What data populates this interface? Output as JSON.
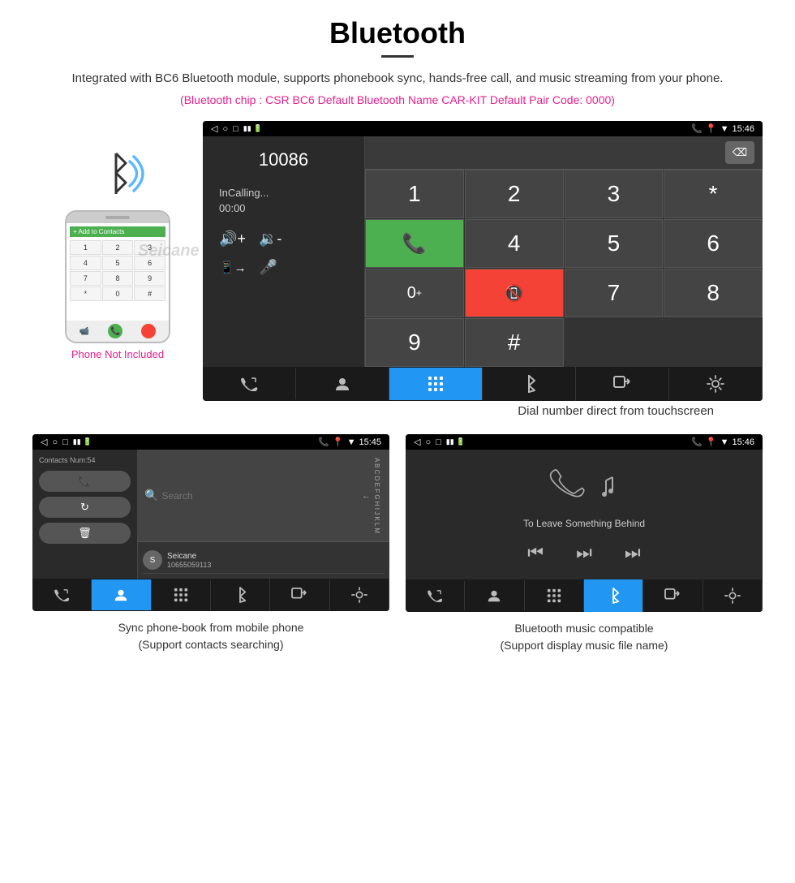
{
  "page": {
    "title": "Bluetooth",
    "divider": true,
    "description": "Integrated with BC6 Bluetooth module, supports phonebook sync, hands-free call, and music streaming from your phone.",
    "specs": "(Bluetooth chip : CSR BC6    Default Bluetooth Name CAR-KIT    Default Pair Code: 0000)"
  },
  "main_screenshot": {
    "status_bar": {
      "time": "15:46",
      "icons_right": "📞 📍 ◀ 🔋"
    },
    "left_panel": {
      "phone_number": "10086",
      "calling_label": "InCalling...",
      "call_time": "00:00"
    },
    "dialpad": {
      "keys": [
        "1",
        "2",
        "3",
        "*",
        "4",
        "5",
        "6",
        "0+",
        "7",
        "8",
        "9",
        "#"
      ],
      "call_btn": "📞",
      "end_btn": "📞"
    },
    "nav_bar": {
      "items": [
        "📞↔",
        "👤",
        "⠿",
        "✱",
        "⬛",
        "⚙"
      ],
      "active_index": 2
    }
  },
  "phone_aside": {
    "not_included_text": "Phone Not Included",
    "watermark": "Seicane"
  },
  "main_caption": "Dial number direct from touchscreen",
  "bottom_left": {
    "status_time": "15:45",
    "contacts_count": "Contacts Num:54",
    "buttons": [
      "📞",
      "↻",
      "🗑"
    ],
    "search_placeholder": "Search",
    "contact_name": "Seicane",
    "contact_number": "10655059113",
    "caption_line1": "Sync phone-book from mobile phone",
    "caption_line2": "(Support contacts searching)"
  },
  "bottom_right": {
    "status_time": "15:46",
    "song_title": "To Leave Something Behind",
    "controls": [
      "⏮",
      "⏭",
      "⏭"
    ],
    "nav_active": "bluetooth",
    "caption_line1": "Bluetooth music compatible",
    "caption_line2": "(Support display music file name)"
  }
}
